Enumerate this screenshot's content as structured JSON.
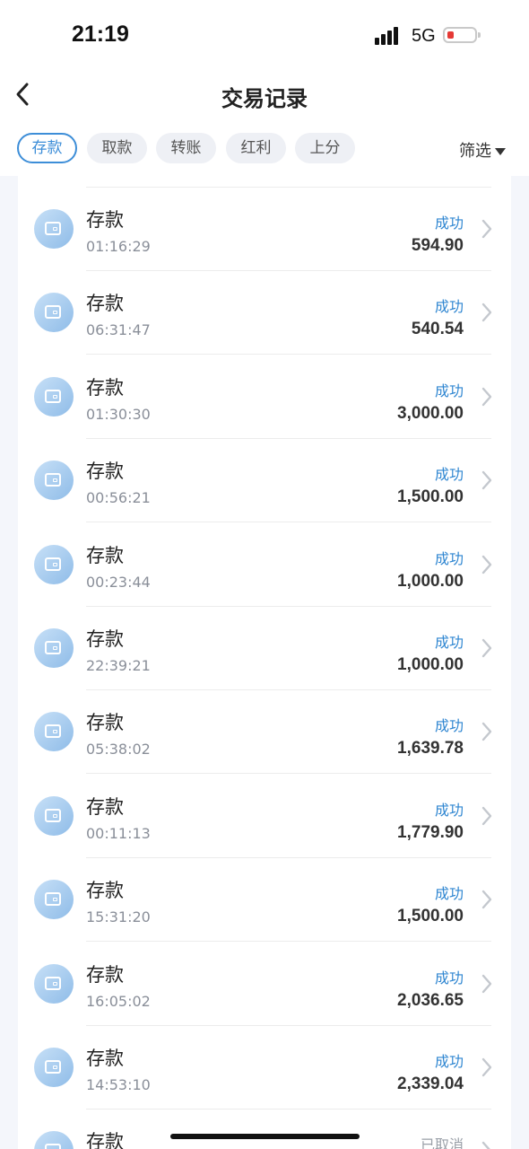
{
  "status_bar": {
    "time": "21:19",
    "network": "5G"
  },
  "header": {
    "title": "交易记录"
  },
  "tabs": [
    {
      "label": "存款",
      "active": true
    },
    {
      "label": "取款",
      "active": false
    },
    {
      "label": "转账",
      "active": false
    },
    {
      "label": "红利",
      "active": false
    },
    {
      "label": "上分",
      "active": false
    }
  ],
  "filter_label": "筛选",
  "transactions": [
    {
      "type": "存款",
      "time": "01:16:29",
      "status": "成功",
      "amount": "594.90"
    },
    {
      "type": "存款",
      "time": "06:31:47",
      "status": "成功",
      "amount": "540.54"
    },
    {
      "type": "存款",
      "time": "01:30:30",
      "status": "成功",
      "amount": "3,000.00"
    },
    {
      "type": "存款",
      "time": "00:56:21",
      "status": "成功",
      "amount": "1,500.00"
    },
    {
      "type": "存款",
      "time": "00:23:44",
      "status": "成功",
      "amount": "1,000.00"
    },
    {
      "type": "存款",
      "time": "22:39:21",
      "status": "成功",
      "amount": "1,000.00"
    },
    {
      "type": "存款",
      "time": "05:38:02",
      "status": "成功",
      "amount": "1,639.78"
    },
    {
      "type": "存款",
      "time": "00:11:13",
      "status": "成功",
      "amount": "1,779.90"
    },
    {
      "type": "存款",
      "time": "15:31:20",
      "status": "成功",
      "amount": "1,500.00"
    },
    {
      "type": "存款",
      "time": "16:05:02",
      "status": "成功",
      "amount": "2,036.65"
    },
    {
      "type": "存款",
      "time": "14:53:10",
      "status": "成功",
      "amount": "2,339.04"
    },
    {
      "type": "存款",
      "time": "",
      "status": "已取消",
      "amount": ""
    }
  ],
  "colors": {
    "accent": "#2f86d1",
    "cancelled": "#9aa0a8",
    "battery_low": "#e53935"
  },
  "icons": {
    "back": "chevron-left-icon",
    "row": "wallet-icon",
    "row_arrow": "chevron-right-icon",
    "filter": "caret-down-icon"
  }
}
